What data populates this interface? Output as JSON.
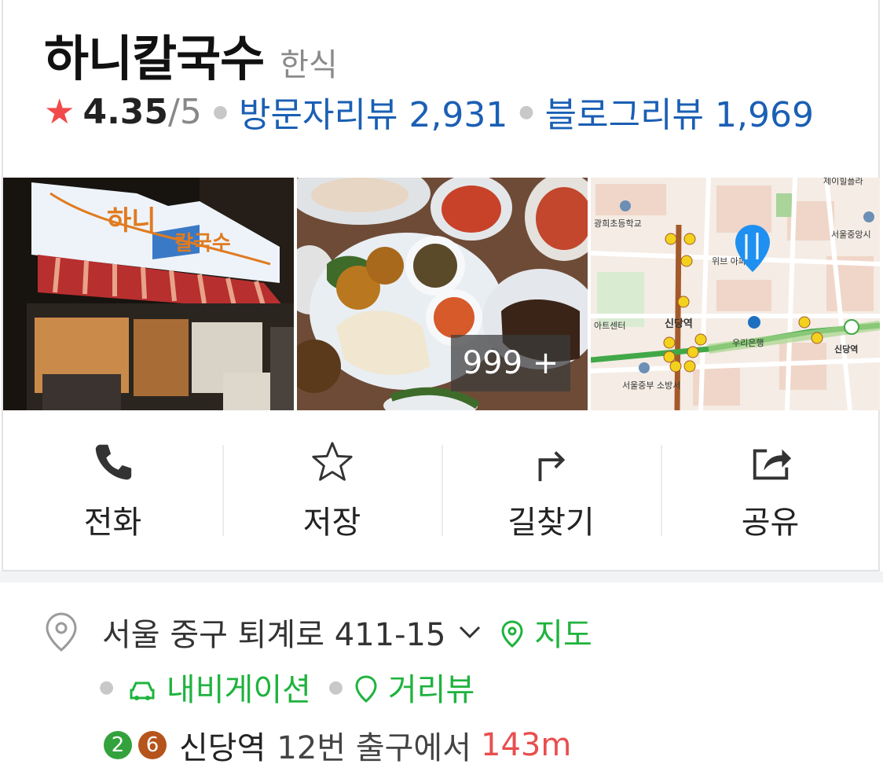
{
  "place": {
    "name": "하니칼국수",
    "category": "한식"
  },
  "rating": {
    "score": "4.35",
    "max": "/5",
    "visitor_reviews_label": "방문자리뷰",
    "visitor_reviews_count": "2,931",
    "blog_reviews_label": "블로그리뷰",
    "blog_reviews_count": "1,969"
  },
  "photos": {
    "sign_text_1": "하니",
    "sign_text_2": "칼국수",
    "more_count": "999 +",
    "map_labels": {
      "school": "광희초등학교",
      "apartment": "위브 아파트",
      "center": "아트센터",
      "station": "신당역",
      "bank": "우리은행",
      "station_right": "신당역",
      "fire": "서울중부 소방서",
      "top_right": "서울중앙시",
      "top": "제이힐플라"
    }
  },
  "actions": [
    {
      "label": "전화",
      "icon": "phone-icon"
    },
    {
      "label": "저장",
      "icon": "star-outline-icon"
    },
    {
      "label": "길찾기",
      "icon": "directions-icon"
    },
    {
      "label": "공유",
      "icon": "share-icon"
    }
  ],
  "address": {
    "text": "서울 중구 퇴계로 411-15",
    "map_link": "지도",
    "navigation_link": "내비게이션",
    "streetview_link": "거리뷰"
  },
  "subway": {
    "lines": [
      {
        "number": "2",
        "color": "#33a23d"
      },
      {
        "number": "6",
        "color": "#b5541b"
      }
    ],
    "station": "신당역",
    "exit": "12번 출구에서",
    "distance": "143m"
  },
  "colors": {
    "star": "#f04a4a",
    "link_blue": "#1a5fb4",
    "link_green": "#1fb33e",
    "distance_red": "#e94e4e"
  }
}
